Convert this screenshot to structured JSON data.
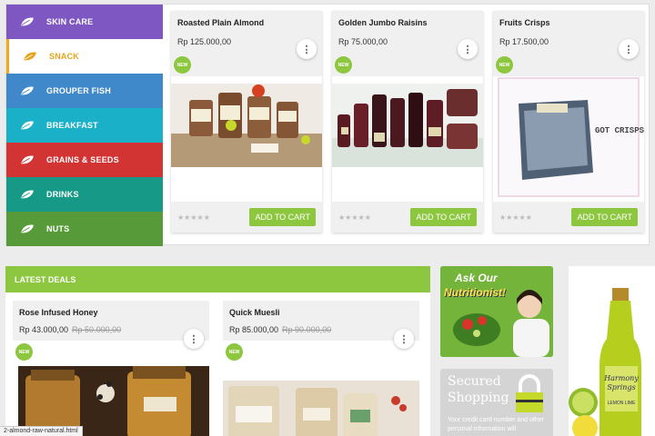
{
  "categories": [
    {
      "label": "SKIN CARE",
      "color": "#7e57c2"
    },
    {
      "label": "SNACK",
      "color": "#ffffff"
    },
    {
      "label": "GROUPER FISH",
      "color": "#3f88c9"
    },
    {
      "label": "BREAKFAST",
      "color": "#19b0c8"
    },
    {
      "label": "GRAINS & SEEDS",
      "color": "#d23333"
    },
    {
      "label": "DRINKS",
      "color": "#169a87"
    },
    {
      "label": "NUTS",
      "color": "#579a3a"
    }
  ],
  "products": [
    {
      "title": "Roasted Plain Almond",
      "price": "Rp 125.000,00",
      "badge": "NEW",
      "menu": "⋮",
      "cart": "ADD TO CART",
      "stars": "★★★★★"
    },
    {
      "title": "Golden Jumbo Raisins",
      "price": "Rp 75.000,00",
      "badge": "NEW",
      "menu": "⋮",
      "cart": "ADD TO CART",
      "stars": "★★★★★"
    },
    {
      "title": "Fruits Crisps",
      "price": "Rp 17.500,00",
      "badge": "NEW",
      "menu": "⋮",
      "cart": "ADD TO CART",
      "stars": "★★★★★",
      "image_text": "GOT CRISPS?"
    }
  ],
  "deals": {
    "heading": "LATEST DEALS",
    "items": [
      {
        "title": "Rose Infused Honey",
        "price": "Rp 43.000,00",
        "old_price": "Rp 50.000,00",
        "badge": "NEW",
        "menu": "⋮"
      },
      {
        "title": "Quick Muesli",
        "price": "Rp 85.000,00",
        "old_price": "Rp 90.000,00",
        "badge": "NEW",
        "menu": "⋮"
      }
    ]
  },
  "ads": {
    "nutritionist": {
      "line1": "Ask Our",
      "line2": "Nutritionist!"
    },
    "secured": {
      "line1": "Secured",
      "line2": "Shopping",
      "body": "Your credit card number and other personal information will"
    },
    "drink": {
      "brand1": "Harmony",
      "brand2": "Springs",
      "flavor": "LEMON LIME"
    }
  },
  "status_url": "2-almond-raw-natural.html",
  "colors": {
    "accent_green": "#8dc63f",
    "snack_orange": "#e8a31b"
  }
}
